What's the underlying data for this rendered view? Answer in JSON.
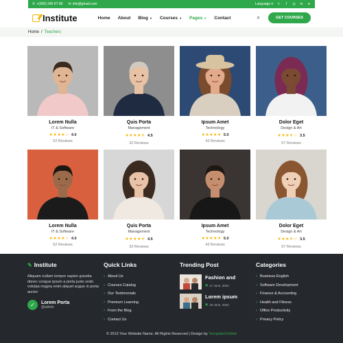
{
  "topbar": {
    "phone": "+(000) 345 67 89",
    "email": "info@gmail.com",
    "language": "Language"
  },
  "navbar": {
    "brand": "Institute",
    "items": [
      {
        "label": "Home",
        "dropdown": false,
        "active": false
      },
      {
        "label": "About",
        "dropdown": false,
        "active": false
      },
      {
        "label": "Blog",
        "dropdown": true,
        "active": false
      },
      {
        "label": "Courses",
        "dropdown": true,
        "active": false
      },
      {
        "label": "Pages",
        "dropdown": true,
        "active": true
      },
      {
        "label": "Contact",
        "dropdown": false,
        "active": false
      }
    ],
    "cta": "GET COURSES"
  },
  "breadcrumb": {
    "home": "Home",
    "sep": "/",
    "current": "Teachers"
  },
  "teachers": [
    {
      "name": "Lorem Nulla",
      "role": "IT & Software",
      "rating": "4.0",
      "stars": 4,
      "reviews": "62 Reviews"
    },
    {
      "name": "Quis Porta",
      "role": "Management",
      "rating": "4.5",
      "stars": 4.5,
      "reviews": "32 Reviews"
    },
    {
      "name": "Ipsum Amet",
      "role": "Technology",
      "rating": "5.0",
      "stars": 5,
      "reviews": "43 Reviews"
    },
    {
      "name": "Dolor Eget",
      "role": "Design & Art",
      "rating": "3.5",
      "stars": 3.5,
      "reviews": "57 Reviews"
    },
    {
      "name": "Lorem Nulla",
      "role": "IT & Software",
      "rating": "4.0",
      "stars": 4,
      "reviews": "62 Reviews"
    },
    {
      "name": "Quis Porta",
      "role": "Management",
      "rating": "4.5",
      "stars": 4.5,
      "reviews": "32 Reviews"
    },
    {
      "name": "Ipsum Amet",
      "role": "Technology",
      "rating": "5.0",
      "stars": 5,
      "reviews": "43 Reviews"
    },
    {
      "name": "Dolor Eget",
      "role": "Design & Art",
      "rating": "3.5",
      "stars": 3.5,
      "reviews": "57 Reviews"
    }
  ],
  "footer": {
    "about": {
      "title": "Institute",
      "text": "Aliquam nullam tempor sapien gravida donec congue ipsum a porta justo undo volutpa magna enim aliquet augue in porta auctor",
      "author_name": "Lorem Porta",
      "author_handle": "@admin"
    },
    "quick_links": {
      "title": "Quick Links",
      "items": [
        "About Us",
        "Courses Catalog",
        "Our Testimonials",
        "Premium Learning",
        "From the Blog",
        "Contact Us"
      ]
    },
    "trending": {
      "title": "Trending Post",
      "posts": [
        {
          "title": "Fashion and",
          "date": "17 June, 2022"
        },
        {
          "title": "Lorem ipsum",
          "date": "19 June, 2022"
        }
      ]
    },
    "categories": {
      "title": "Categories",
      "items": [
        "Business English",
        "Software Development",
        "Finance & Accounting",
        "Health and Fitness",
        "Office Productivity",
        "Privacy Policy"
      ]
    },
    "copyright": "© 2013 Your Website Name. All Rights Reserved | Design by",
    "credit": "TemplateOnWeb"
  },
  "colors": {
    "accent": "#2ea84a",
    "star": "#f5b400",
    "footer_bg": "#25282d"
  }
}
